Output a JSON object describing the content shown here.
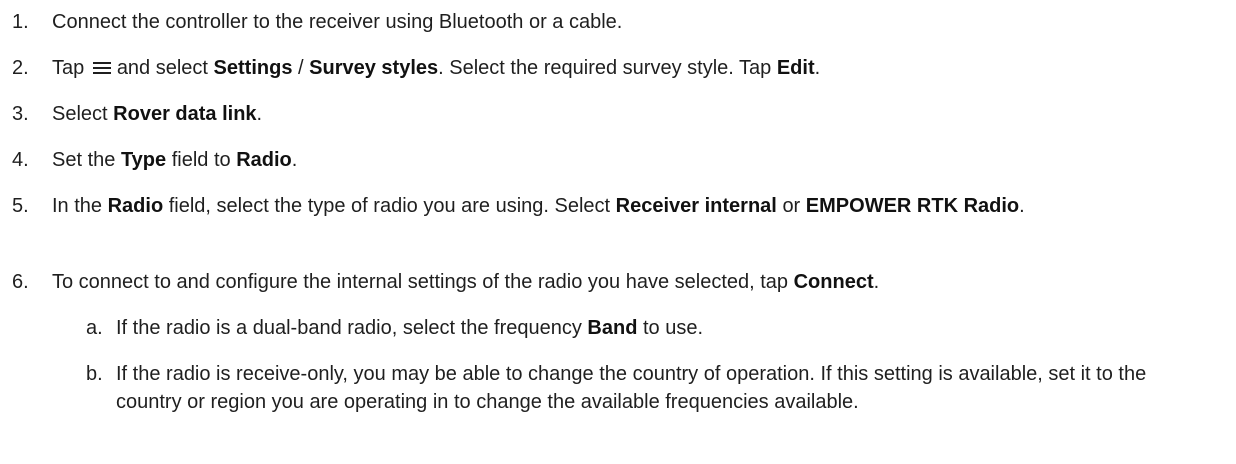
{
  "steps": [
    {
      "num": "1.",
      "text": "Connect the controller to the receiver using Bluetooth or a cable."
    },
    {
      "num": "2.",
      "pre": "Tap",
      "icon": "hamburger-menu-icon",
      "mid1": "and select",
      "b1": "Settings",
      "sep": "/",
      "b2": "Survey styles",
      "mid2": ". Select the required survey style. Tap",
      "b3": "Edit",
      "end": "."
    },
    {
      "num": "3.",
      "pre": "Select",
      "b1": "Rover data link",
      "end": "."
    },
    {
      "num": "4.",
      "pre": "Set the",
      "b1": "Type",
      "mid1": "field to",
      "b2": "Radio",
      "end": "."
    },
    {
      "num": "5.",
      "pre": "In the",
      "b1": "Radio",
      "mid1": "field, select the type of radio you are using. Select",
      "b2": "Receiver internal",
      "mid2": "or",
      "b3": "EMPOWER RTK Radio",
      "end": "."
    },
    {
      "num": "6.",
      "pre": "To connect to and configure the internal settings of the radio you have selected, tap",
      "b1": "Connect",
      "end": ".",
      "substeps": [
        {
          "num": "a.",
          "pre": "If the radio is a dual-band radio, select the frequency",
          "b1": "Band",
          "mid1": "to use."
        },
        {
          "num": "b.",
          "text": "If the radio is receive-only, you may be able to change the country of operation. If this setting is available, set it to the country or region you are operating in to change the available frequencies available."
        }
      ]
    }
  ]
}
